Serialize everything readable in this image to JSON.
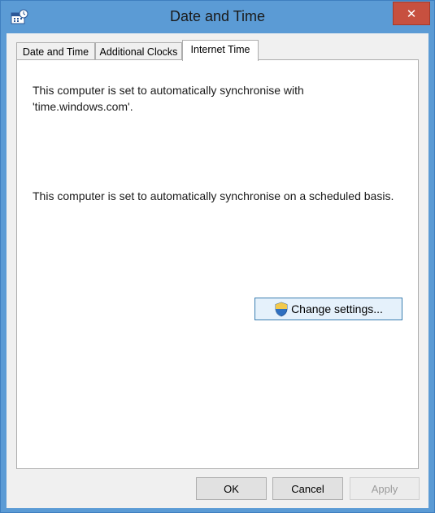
{
  "window": {
    "title": "Date and Time",
    "close_glyph": "✕"
  },
  "tabs": [
    {
      "label": "Date and Time",
      "selected": false
    },
    {
      "label": "Additional Clocks",
      "selected": false
    },
    {
      "label": "Internet Time",
      "selected": true
    }
  ],
  "internet_time": {
    "sync_server_text": "This computer is set to automatically synchronise with 'time.windows.com'.",
    "sync_schedule_text": "This computer is set to automatically synchronise on a scheduled basis.",
    "change_settings_label": "Change settings..."
  },
  "footer": {
    "ok_label": "OK",
    "cancel_label": "Cancel",
    "apply_label": "Apply",
    "apply_enabled": false
  },
  "icons": {
    "app_icon": "date-time-icon",
    "close_icon": "close-icon",
    "shield_icon": "uac-shield-icon"
  },
  "colors": {
    "frame": "#5b9bd5",
    "close_button": "#c7503f",
    "client_background": "#f0f0f0",
    "button_focus_border": "#3c7fb1"
  }
}
